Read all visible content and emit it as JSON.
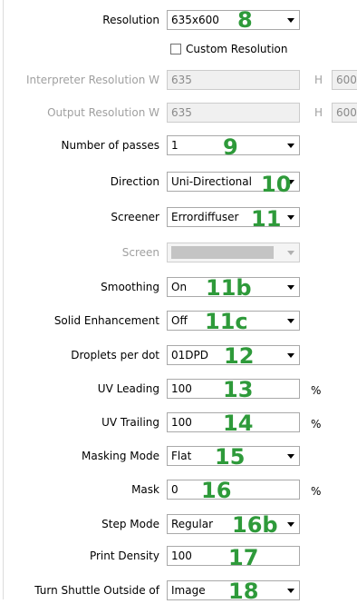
{
  "resolution": {
    "label": "Resolution",
    "value": "635x600",
    "badge": "8"
  },
  "custom_resolution": {
    "label": "Custom Resolution",
    "checked": false
  },
  "interpreter_resolution": {
    "label": "Interpreter Resolution W",
    "w": "635",
    "h_label": "H",
    "h": "600"
  },
  "output_resolution": {
    "label": "Output Resolution W",
    "w": "635",
    "h_label": "H",
    "h": "600"
  },
  "passes": {
    "label": "Number of passes",
    "value": "1",
    "badge": "9"
  },
  "direction": {
    "label": "Direction",
    "value": "Uni-Directional",
    "badge": "10"
  },
  "screener": {
    "label": "Screener",
    "value": "Errordiffuser",
    "badge": "11"
  },
  "screen": {
    "label": "Screen",
    "value": ""
  },
  "smoothing": {
    "label": "Smoothing",
    "value": "On",
    "badge": "11b"
  },
  "solid_enhancement": {
    "label": "Solid Enhancement",
    "value": "Off",
    "badge": "11c"
  },
  "droplets": {
    "label": "Droplets per dot",
    "value": "01DPD",
    "badge": "12"
  },
  "uv_leading": {
    "label": "UV Leading",
    "value": "100",
    "unit": "%",
    "badge": "13"
  },
  "uv_trailing": {
    "label": "UV Trailing",
    "value": "100",
    "unit": "%",
    "badge": "14"
  },
  "masking_mode": {
    "label": "Masking Mode",
    "value": "Flat",
    "badge": "15"
  },
  "mask": {
    "label": "Mask",
    "value": "0",
    "unit": "%",
    "badge": "16"
  },
  "step_mode": {
    "label": "Step Mode",
    "value": "Regular",
    "badge": "16b"
  },
  "print_density": {
    "label": "Print Density",
    "value": "100",
    "badge": "17"
  },
  "turn_shuttle": {
    "label": "Turn Shuttle Outside of",
    "value": "Image",
    "badge": "18"
  },
  "colors": {
    "badge": "#2e9a3a",
    "disabled_text": "#a0a0a0"
  }
}
